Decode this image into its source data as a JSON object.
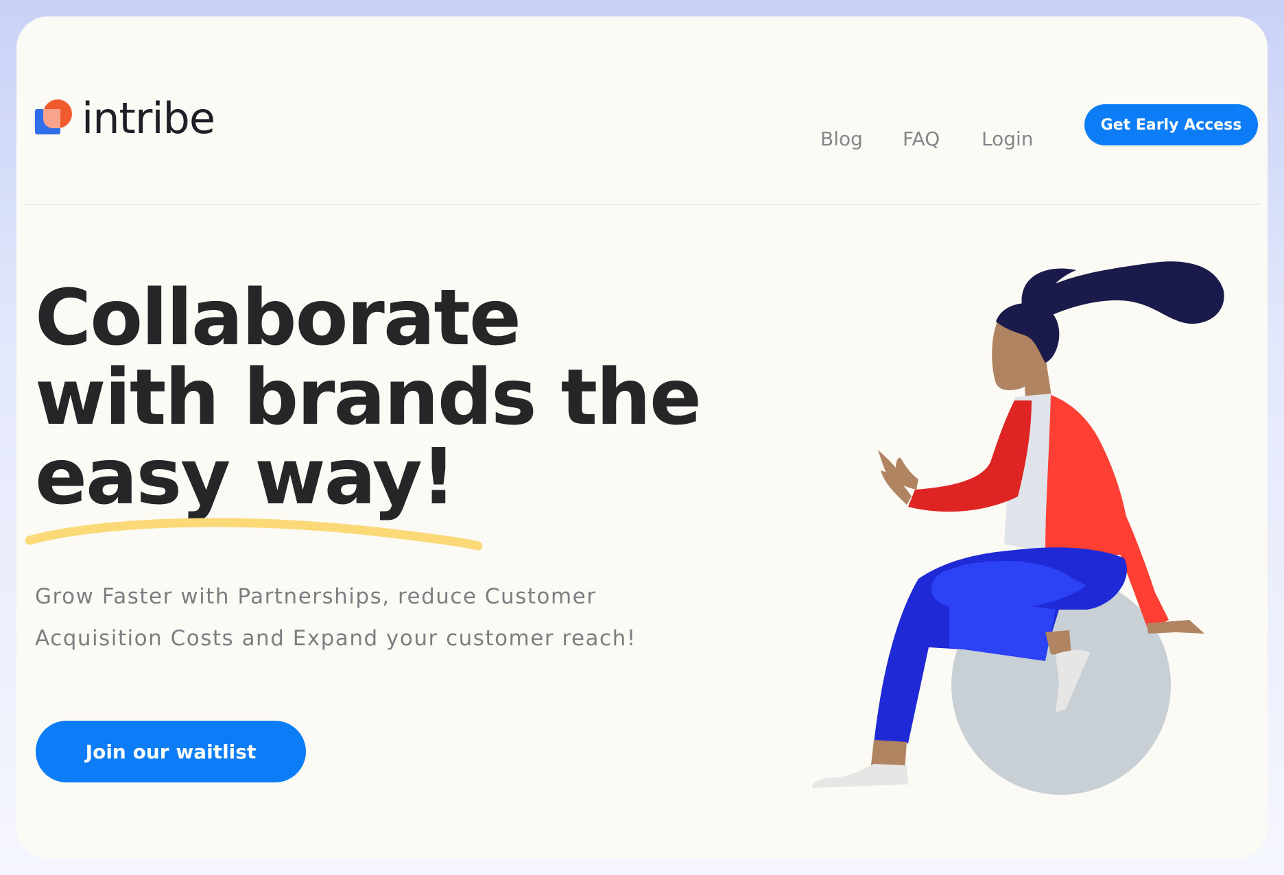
{
  "brand": {
    "name": "intribe"
  },
  "nav": {
    "links": [
      "Blog",
      "FAQ",
      "Login"
    ],
    "cta_label": "Get Early Access"
  },
  "hero": {
    "headline_lines": [
      "Collaborate",
      "with brands the",
      "easy way!"
    ],
    "subtext": "Grow Faster with Partnerships, reduce Customer Acquisition Costs and Expand your customer reach!",
    "cta_label": "Join our waitlist"
  },
  "colors": {
    "accent": "#0c7cf7",
    "underline": "#fcd977",
    "background": "#fcfaf4",
    "headline": "#262528"
  },
  "icons": {
    "logo": "intribe-logo-icon",
    "illustration": "woman-sitting-on-ball-illustration"
  }
}
